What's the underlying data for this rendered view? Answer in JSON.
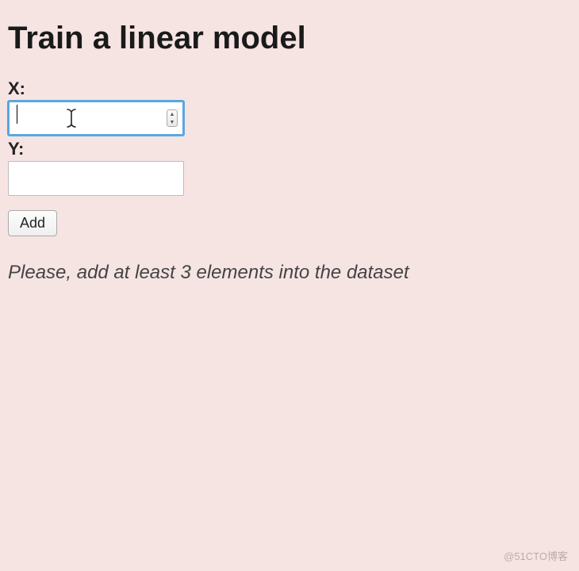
{
  "header": {
    "title": "Train a linear model"
  },
  "form": {
    "x": {
      "label": "X:",
      "value": "",
      "focused": true,
      "placeholder": ""
    },
    "y": {
      "label": "Y:",
      "value": "",
      "focused": false,
      "placeholder": ""
    },
    "add_button_label": "Add"
  },
  "hint_text": "Please, add at least 3 elements into the dataset",
  "watermark": "@51CTO博客"
}
